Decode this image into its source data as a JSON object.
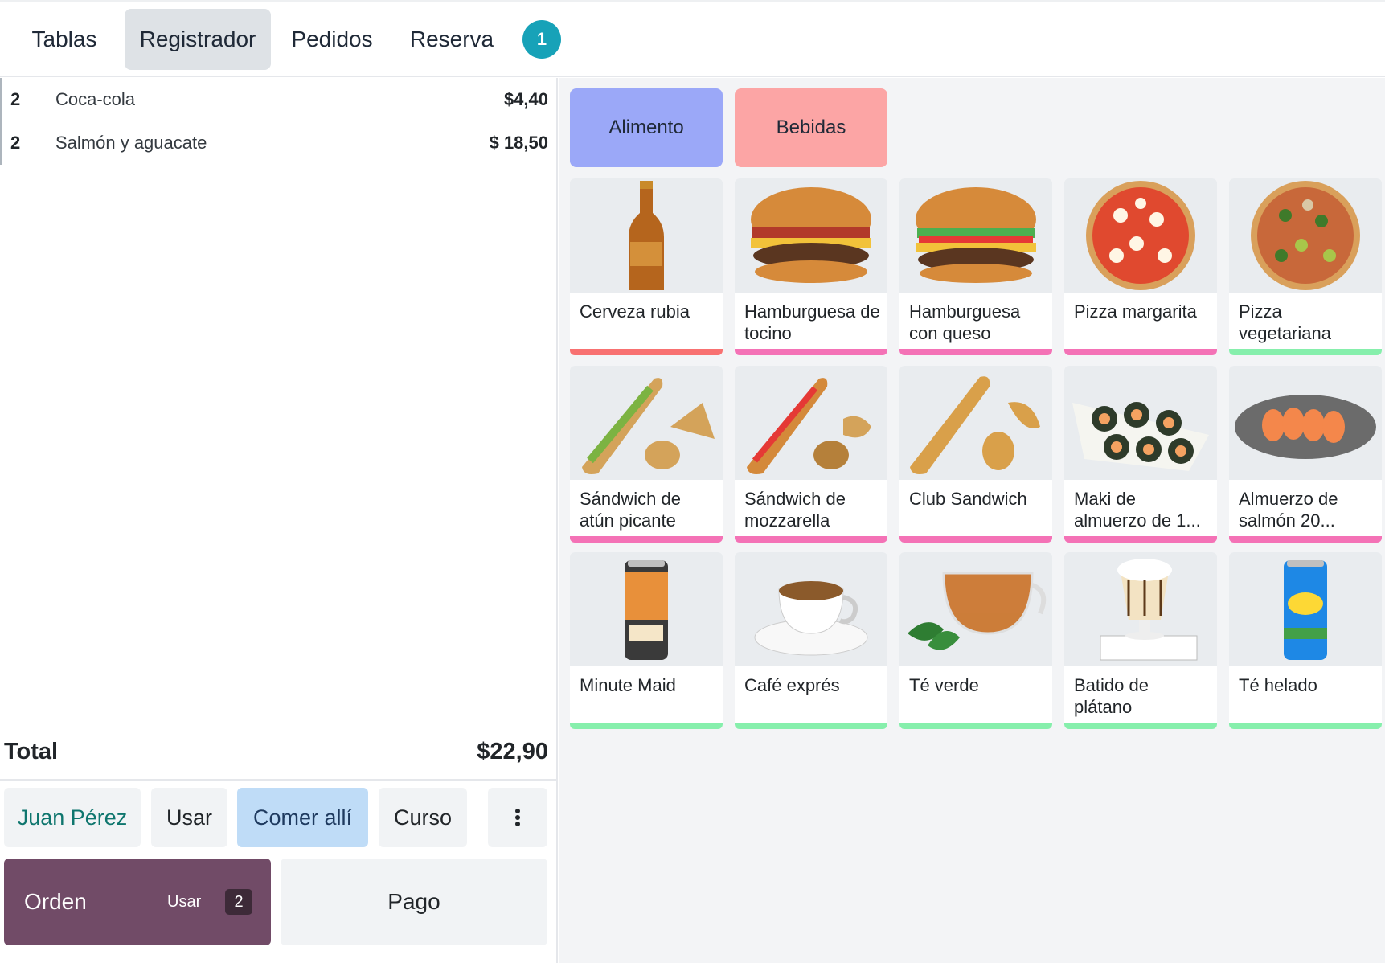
{
  "nav": {
    "tabs": [
      {
        "label": "Tablas",
        "active": false
      },
      {
        "label": "Registrador",
        "active": true
      },
      {
        "label": "Pedidos",
        "active": false
      },
      {
        "label": "Reserva",
        "active": false
      }
    ],
    "badge": "1"
  },
  "order": {
    "lines": [
      {
        "qty": "2",
        "name": "Coca-cola",
        "price": "$4,40"
      },
      {
        "qty": "2",
        "name": "Salmón y aguacate",
        "price": "$ 18,50"
      }
    ],
    "total_label": "Total",
    "total_value": "$22,90"
  },
  "controls": {
    "customer": "Juan Pérez",
    "usar": "Usar",
    "dine": "Comer allí",
    "curso": "Curso",
    "more_icon": "more-vertical-icon"
  },
  "actions": {
    "orden_label": "Orden",
    "orden_usar": "Usar",
    "orden_count": "2",
    "pago_label": "Pago"
  },
  "categories": [
    {
      "label": "Alimento",
      "color": "#9ba8f8"
    },
    {
      "label": "Bebidas",
      "color": "#fca5a5"
    }
  ],
  "colors": {
    "accent": "#714b67",
    "badge": "#17a2b8",
    "bar_red": "#f87171",
    "bar_pink": "#f472b6",
    "bar_green": "#86efac"
  },
  "products": [
    {
      "name": "Cerveza rubia",
      "icon": "beer-bottle-icon",
      "bar": "#f87171"
    },
    {
      "name": "Hamburguesa de tocino",
      "icon": "burger-icon",
      "bar": "#f472b6"
    },
    {
      "name": "Hamburguesa con queso",
      "icon": "burger-icon",
      "bar": "#f472b6"
    },
    {
      "name": "Pizza margarita",
      "icon": "pizza-icon",
      "bar": "#f472b6"
    },
    {
      "name": "Pizza vegetariana",
      "icon": "pizza-icon",
      "bar": "#86efac"
    },
    {
      "name": "Sándwich de atún picante",
      "icon": "sandwich-icon",
      "bar": "#f472b6"
    },
    {
      "name": "Sándwich de mozzarella",
      "icon": "sandwich-icon",
      "bar": "#f472b6"
    },
    {
      "name": "Club Sandwich",
      "icon": "sandwich-icon",
      "bar": "#f472b6"
    },
    {
      "name": "Maki de almuerzo de 1...",
      "icon": "sushi-icon",
      "bar": "#f472b6"
    },
    {
      "name": "Almuerzo de salmón 20...",
      "icon": "salmon-icon",
      "bar": "#f472b6"
    },
    {
      "name": "Minute Maid",
      "icon": "can-icon",
      "bar": "#86efac"
    },
    {
      "name": "Café exprés",
      "icon": "coffee-cup-icon",
      "bar": "#86efac"
    },
    {
      "name": "Té verde",
      "icon": "tea-cup-icon",
      "bar": "#86efac"
    },
    {
      "name": "Batido de plátano",
      "icon": "milkshake-icon",
      "bar": "#86efac"
    },
    {
      "name": "Té helado",
      "icon": "can-icon",
      "bar": "#86efac"
    }
  ]
}
